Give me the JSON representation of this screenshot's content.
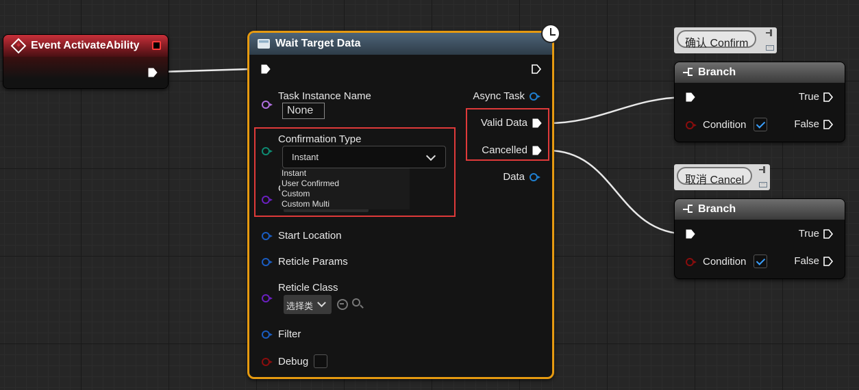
{
  "event_node": {
    "title": "Event ActivateAbility"
  },
  "wait_target_data": {
    "title": "Wait Target Data",
    "inputs": {
      "task_instance_name": "Task Instance Name",
      "task_instance_value": "None",
      "confirmation_type": "Confirmation Type",
      "confirmation_selected": "Instant",
      "confirmation_options": [
        "Instant",
        "User Confirmed",
        "Custom",
        "Custom Multi"
      ],
      "hidden_label_fragment": "C",
      "start_location": "Start Location",
      "reticle_params": "Reticle Params",
      "reticle_class": "Reticle Class",
      "reticle_class_value": "选择类",
      "filter": "Filter",
      "debug": "Debug"
    },
    "outputs": {
      "async_task": "Async Task",
      "valid_data": "Valid Data",
      "cancelled": "Cancelled",
      "data": "Data"
    }
  },
  "branch_confirm": {
    "comment": "确认 Confirm",
    "title": "Branch",
    "condition": "Condition",
    "true_label": "True",
    "false_label": "False"
  },
  "branch_cancel": {
    "comment": "取消 Cancel",
    "title": "Branch",
    "condition": "Condition",
    "true_label": "True",
    "false_label": "False"
  },
  "colors": {
    "event_header": "#c8303a",
    "latent_border": "#e69a10",
    "function_header": "#4d6478",
    "highlight": "#e03a3a",
    "check": "#3aa0ff"
  }
}
